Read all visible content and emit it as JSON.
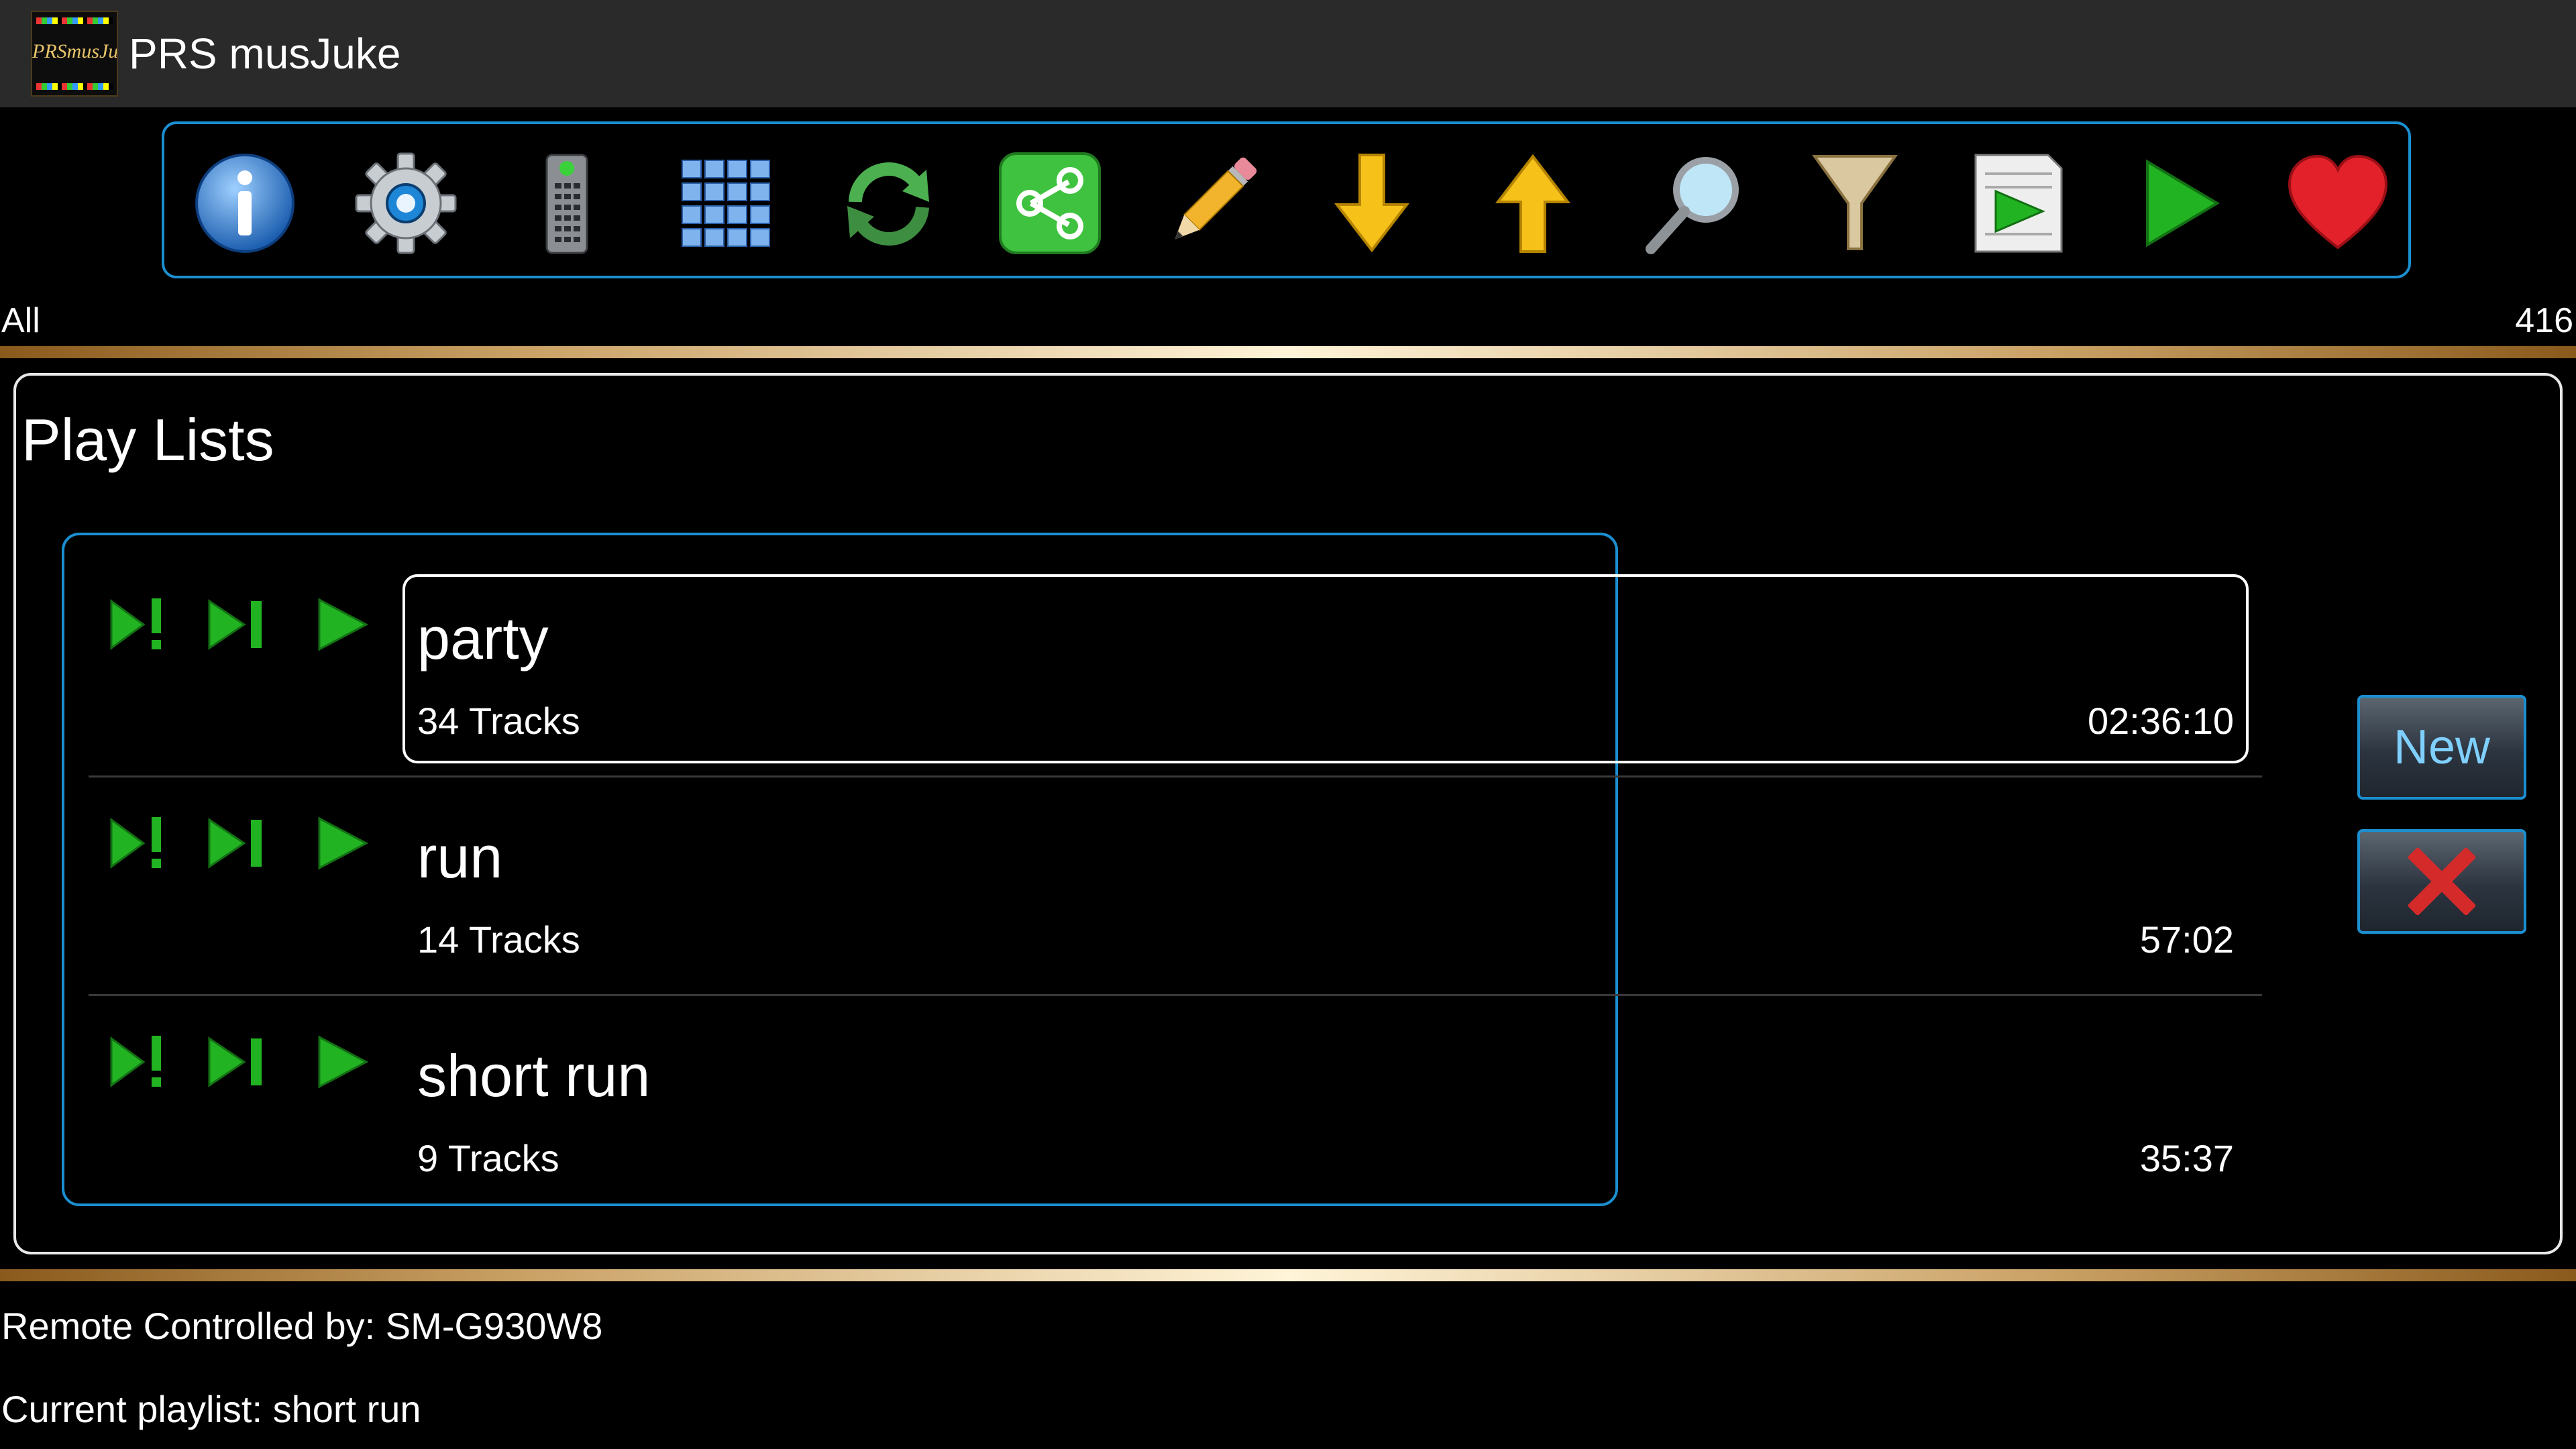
{
  "app": {
    "title": "PRS musJuke",
    "logo_text": "PRSmusJuke"
  },
  "toolbar": {
    "buttons": [
      {
        "icon": "info-icon"
      },
      {
        "icon": "gear-icon"
      },
      {
        "icon": "remote-control-icon"
      },
      {
        "icon": "grid-icon"
      },
      {
        "icon": "refresh-icon"
      },
      {
        "icon": "share-icon"
      },
      {
        "icon": "pencil-icon"
      },
      {
        "icon": "arrow-down-icon"
      },
      {
        "icon": "arrow-up-icon"
      },
      {
        "icon": "search-icon"
      },
      {
        "icon": "filter-icon"
      },
      {
        "icon": "playlist-icon"
      },
      {
        "icon": "play-icon"
      },
      {
        "icon": "heart-icon"
      }
    ]
  },
  "filter": {
    "label": "All",
    "count": "416"
  },
  "playlists": {
    "title": "Play Lists",
    "controls": [
      "play-next-icon",
      "skip-next-icon",
      "play-icon"
    ],
    "items": [
      {
        "name": "party",
        "tracks": "34 Tracks",
        "duration": "02:36:10",
        "selected": true
      },
      {
        "name": "run",
        "tracks": "14 Tracks",
        "duration": "57:02",
        "selected": false
      },
      {
        "name": "short run",
        "tracks": "9 Tracks",
        "duration": "35:37",
        "selected": false
      }
    ]
  },
  "actions": {
    "new_label": "New",
    "delete_icon": "close-icon"
  },
  "status": {
    "remote": "Remote Controlled by: SM-G930W8",
    "current": "Current playlist: short run"
  },
  "colors": {
    "accent": "#1b8fd0",
    "play_green": "#22b322",
    "gold": "#c9a064",
    "delete_red": "#d42a2a"
  }
}
